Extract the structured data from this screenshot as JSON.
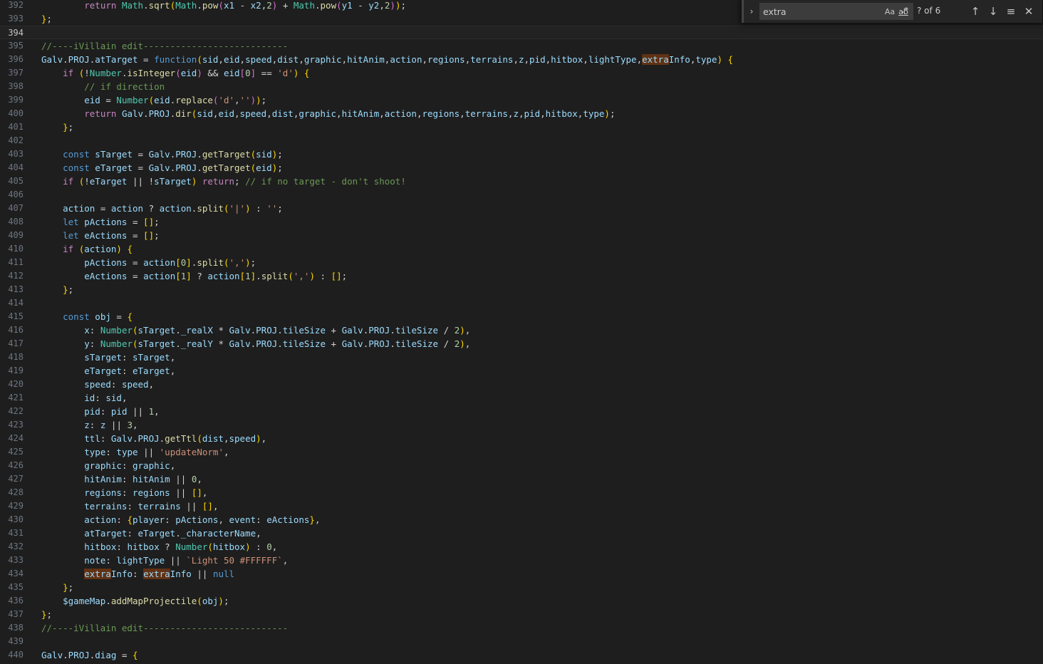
{
  "find_widget": {
    "toggle_icon": "chevron-right-icon",
    "query": "extra",
    "match_case_label": "Aa",
    "whole_word_label": "ab",
    "regex_label": ".*",
    "result_count": "? of 6",
    "prev_icon": "arrow-up-icon",
    "next_icon": "arrow-down-icon",
    "selection_icon": "find-in-selection-icon",
    "close_icon": "close-icon"
  },
  "editor": {
    "current_line": "394",
    "highlight_color": "#613214",
    "lines": [
      {
        "n": "392",
        "t": "        return Math.sqrt(Math.pow(x1 - x2,2) + Math.pow(y1 - y2,2));"
      },
      {
        "n": "393",
        "t": "};"
      },
      {
        "n": "394",
        "t": ""
      },
      {
        "n": "395",
        "t": "//----iVillain edit---------------------------"
      },
      {
        "n": "396",
        "t": "Galv.PROJ.atTarget = function(sid,eid,speed,dist,graphic,hitAnim,action,regions,terrains,z,pid,hitbox,lightType,extraInfo,type) {"
      },
      {
        "n": "397",
        "t": "    if (!Number.isInteger(eid) && eid[0] == 'd') {"
      },
      {
        "n": "398",
        "t": "        // if direction"
      },
      {
        "n": "399",
        "t": "        eid = Number(eid.replace('d',''));"
      },
      {
        "n": "400",
        "t": "        return Galv.PROJ.dir(sid,eid,speed,dist,graphic,hitAnim,action,regions,terrains,z,pid,hitbox,type);"
      },
      {
        "n": "401",
        "t": "    };"
      },
      {
        "n": "402",
        "t": ""
      },
      {
        "n": "403",
        "t": "    const sTarget = Galv.PROJ.getTarget(sid);"
      },
      {
        "n": "404",
        "t": "    const eTarget = Galv.PROJ.getTarget(eid);"
      },
      {
        "n": "405",
        "t": "    if (!eTarget || !sTarget) return; // if no target - don't shoot!"
      },
      {
        "n": "406",
        "t": ""
      },
      {
        "n": "407",
        "t": "    action = action ? action.split('|') : '';"
      },
      {
        "n": "408",
        "t": "    let pActions = [];"
      },
      {
        "n": "409",
        "t": "    let eActions = [];"
      },
      {
        "n": "410",
        "t": "    if (action) {"
      },
      {
        "n": "411",
        "t": "        pActions = action[0].split(',');"
      },
      {
        "n": "412",
        "t": "        eActions = action[1] ? action[1].split(',') : [];"
      },
      {
        "n": "413",
        "t": "    };"
      },
      {
        "n": "414",
        "t": ""
      },
      {
        "n": "415",
        "t": "    const obj = {"
      },
      {
        "n": "416",
        "t": "        x: Number(sTarget._realX * Galv.PROJ.tileSize + Galv.PROJ.tileSize / 2),"
      },
      {
        "n": "417",
        "t": "        y: Number(sTarget._realY * Galv.PROJ.tileSize + Galv.PROJ.tileSize / 2),"
      },
      {
        "n": "418",
        "t": "        sTarget: sTarget,"
      },
      {
        "n": "419",
        "t": "        eTarget: eTarget,"
      },
      {
        "n": "420",
        "t": "        speed: speed,"
      },
      {
        "n": "421",
        "t": "        id: sid,"
      },
      {
        "n": "422",
        "t": "        pid: pid || 1,"
      },
      {
        "n": "423",
        "t": "        z: z || 3,"
      },
      {
        "n": "424",
        "t": "        ttl: Galv.PROJ.getTtl(dist,speed),"
      },
      {
        "n": "425",
        "t": "        type: type || 'updateNorm',"
      },
      {
        "n": "426",
        "t": "        graphic: graphic,"
      },
      {
        "n": "427",
        "t": "        hitAnim: hitAnim || 0,"
      },
      {
        "n": "428",
        "t": "        regions: regions || [],"
      },
      {
        "n": "429",
        "t": "        terrains: terrains || [],"
      },
      {
        "n": "430",
        "t": "        action: {player: pActions, event: eActions},"
      },
      {
        "n": "431",
        "t": "        atTarget: eTarget._characterName,"
      },
      {
        "n": "432",
        "t": "        hitbox: hitbox ? Number(hitbox) : 0,"
      },
      {
        "n": "433",
        "t": "        note: lightType || `Light 50 #FFFFFF`,"
      },
      {
        "n": "434",
        "t": "        extraInfo: extraInfo || null"
      },
      {
        "n": "435",
        "t": "    };"
      },
      {
        "n": "436",
        "t": "    $gameMap.addMapProjectile(obj);"
      },
      {
        "n": "437",
        "t": "};"
      },
      {
        "n": "438",
        "t": "//----iVillain edit---------------------------"
      },
      {
        "n": "439",
        "t": ""
      },
      {
        "n": "440",
        "t": "Galv.PROJ.diag = {"
      }
    ]
  }
}
